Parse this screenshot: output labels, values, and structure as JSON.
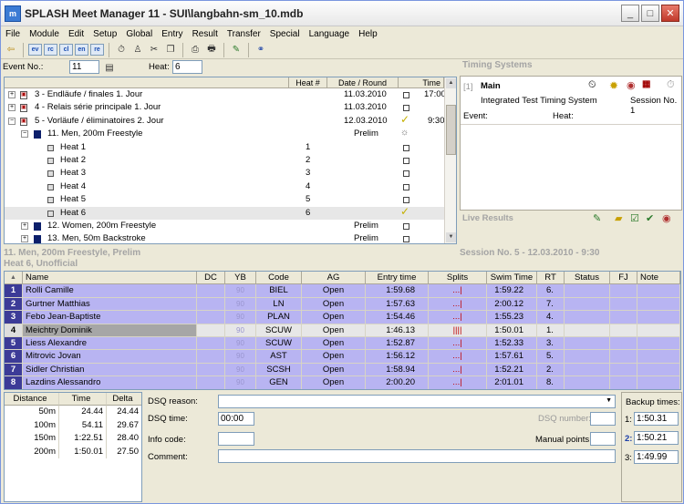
{
  "app": {
    "title": "SPLASH Meet Manager 11 - SUI\\langbahn-sm_10.mdb",
    "icon_text": "m"
  },
  "window_buttons": {
    "minimize": "_",
    "maximize": "□",
    "close": "✕"
  },
  "menus": [
    "File",
    "Module",
    "Edit",
    "Setup",
    "Global",
    "Entry",
    "Result",
    "Transfer",
    "Special",
    "Language",
    "Help"
  ],
  "toolbar": {
    "small_labels": [
      "ev",
      "rc",
      "cl",
      "en",
      "re"
    ]
  },
  "event_bar": {
    "event_label": "Event No.:",
    "event_value": "11",
    "heat_label": "Heat:",
    "heat_value": "6"
  },
  "tree": {
    "headers": {
      "heat": "Heat #",
      "date": "Date / Round",
      "time": "Time"
    },
    "rows": [
      {
        "label": "3 - Endläufe / finales 1. Jour",
        "date": "11.03.2010",
        "time": "17:00",
        "check": "box"
      },
      {
        "label": "4 - Relais série principale 1. Jour",
        "date": "11.03.2010",
        "check": "box"
      },
      {
        "label": "5 - Vorläufe / éliminatoires 2. Jour",
        "date": "12.03.2010",
        "time": "9:30",
        "check": "tick"
      },
      {
        "label": "11. Men, 200m Freestyle",
        "date": "Prelim",
        "check": "sun"
      },
      {
        "label": "Heat 1",
        "heat": "1",
        "check": "box"
      },
      {
        "label": "Heat 2",
        "heat": "2",
        "check": "box"
      },
      {
        "label": "Heat 3",
        "heat": "3",
        "check": "box"
      },
      {
        "label": "Heat 4",
        "heat": "4",
        "check": "box"
      },
      {
        "label": "Heat 5",
        "heat": "5",
        "check": "box"
      },
      {
        "label": "Heat 6",
        "heat": "6",
        "check": "tick"
      },
      {
        "label": "12. Women, 200m Freestyle",
        "date": "Prelim",
        "check": "box"
      },
      {
        "label": "13. Men, 50m Backstroke",
        "date": "Prelim",
        "check": "box"
      }
    ]
  },
  "timing": {
    "title": "Timing Systems",
    "main_index": "[1]",
    "main_label": "Main",
    "system_name": "Integrated Test Timing System",
    "session": "Session No. 1",
    "event_label": "Event:",
    "heat_label": "Heat:",
    "live_results": "Live Results"
  },
  "heat_info": {
    "line1": "11. Men, 200m Freestyle, Prelim",
    "line2": "Heat 6, Unofficial",
    "session": "Session  No. 5 - 12.03.2010 - 9:30"
  },
  "grid": {
    "headers": [
      "",
      "Name",
      "DC",
      "YB",
      "Code",
      "AG",
      "Entry time",
      "Splits",
      "Swim Time",
      "RT",
      "Status",
      "FJ",
      "Note"
    ],
    "sort_indicator": "▲",
    "rows": [
      {
        "lane": "1",
        "name": "Rolli Camille",
        "yb": "90",
        "code": "BIEL",
        "ag": "Open",
        "entry": "1:59.68",
        "splits": "...|",
        "swim": "1:59.22",
        "rt": "6."
      },
      {
        "lane": "2",
        "name": "Gurtner Matthias",
        "yb": "90",
        "code": "LN",
        "ag": "Open",
        "entry": "1:57.63",
        "splits": "...|",
        "swim": "2:00.12",
        "rt": "7."
      },
      {
        "lane": "3",
        "name": "Febo Jean-Baptiste",
        "yb": "90",
        "code": "PLAN",
        "ag": "Open",
        "entry": "1:54.46",
        "splits": "...|",
        "swim": "1:55.23",
        "rt": "4."
      },
      {
        "lane": "4",
        "name": "Meichtry Dominik",
        "yb": "90",
        "code": "SCUW",
        "ag": "Open",
        "entry": "1:46.13",
        "splits": "||||",
        "swim": "1:50.01",
        "rt": "1.",
        "selected": true
      },
      {
        "lane": "5",
        "name": "Liess Alexandre",
        "yb": "90",
        "code": "SCUW",
        "ag": "Open",
        "entry": "1:52.87",
        "splits": "...|",
        "swim": "1:52.33",
        "rt": "3."
      },
      {
        "lane": "6",
        "name": "Mitrovic Jovan",
        "yb": "90",
        "code": "AST",
        "ag": "Open",
        "entry": "1:56.12",
        "splits": "...|",
        "swim": "1:57.61",
        "rt": "5."
      },
      {
        "lane": "7",
        "name": "Sidler Christian",
        "yb": "90",
        "code": "SCSH",
        "ag": "Open",
        "entry": "1:58.94",
        "splits": "...|",
        "swim": "1:52.21",
        "rt": "2."
      },
      {
        "lane": "8",
        "name": "Lazdins Alessandro",
        "yb": "90",
        "code": "GEN",
        "ag": "Open",
        "entry": "2:00.20",
        "splits": "...|",
        "swim": "2:01.01",
        "rt": "8."
      }
    ]
  },
  "splits": {
    "headers": [
      "Distance",
      "Time",
      "Delta"
    ],
    "rows": [
      [
        "50m",
        "24.44",
        "24.44"
      ],
      [
        "100m",
        "54.11",
        "29.67"
      ],
      [
        "150m",
        "1:22.51",
        "28.40"
      ],
      [
        "200m",
        "1:50.01",
        "27.50"
      ]
    ]
  },
  "dsq": {
    "reason_label": "DSQ reason:",
    "time_label": "DSQ time:",
    "time_value": "00:00",
    "info_label": "Info code:",
    "comment_label": "Comment:",
    "number_label": "DSQ number:",
    "manual_label": "Manual points:"
  },
  "backup": {
    "title": "Backup times:",
    "items": [
      {
        "n": "1:",
        "v": "1:50.31"
      },
      {
        "n": "2:",
        "v": "1:50.21"
      },
      {
        "n": "3:",
        "v": "1:49.99"
      }
    ]
  }
}
